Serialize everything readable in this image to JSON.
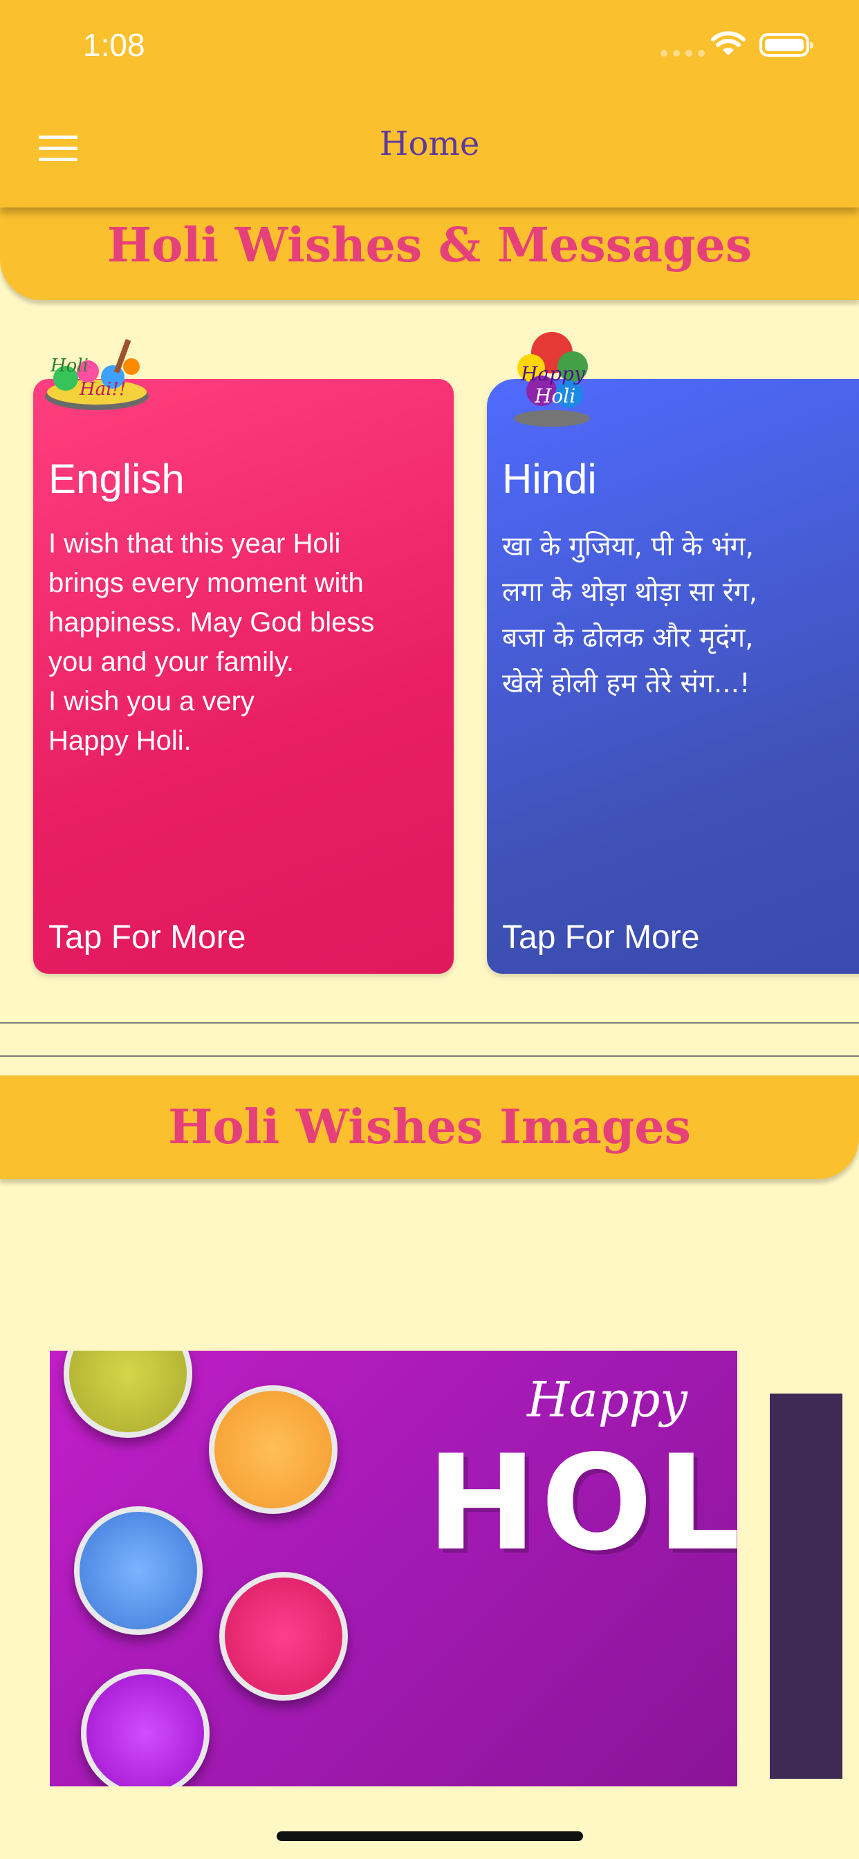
{
  "status_bar": {
    "time": "1:08"
  },
  "app_bar": {
    "title": "Home",
    "menu_icon": "hamburger-menu-icon"
  },
  "sections": {
    "messages_header": "Holi Wishes & Messages",
    "images_header": "Holi Wishes Images"
  },
  "cards": [
    {
      "language": "English",
      "message": "I wish that this year Holi\nbrings every moment with\nhappiness. May God bless\nyou and your family.\nI wish you a very\nHappy Holi.",
      "more_label": "Tap For More"
    },
    {
      "language": "Hindi",
      "message": "खा के गुजिया, पी के भंग,\nलगा के थोड़ा थोड़ा सा रंग,\nबजा के ढोलक और मृदंग,\nखेलें होली हम तेरे संग...!",
      "more_label": "Tap For More"
    }
  ],
  "sticker_text": {
    "english": "Holi Hai!!",
    "hindi": "Happy Holi"
  },
  "carousel": {
    "image_text_script": "Happy",
    "image_text_main": "HOLI"
  },
  "colors": {
    "app_bar": "#FBC02D",
    "background": "#FFF7C4",
    "header_text": "#E6407A",
    "title_text": "#5C3A9E",
    "english_card": "#E91E63",
    "hindi_card": "#3F51B5"
  }
}
